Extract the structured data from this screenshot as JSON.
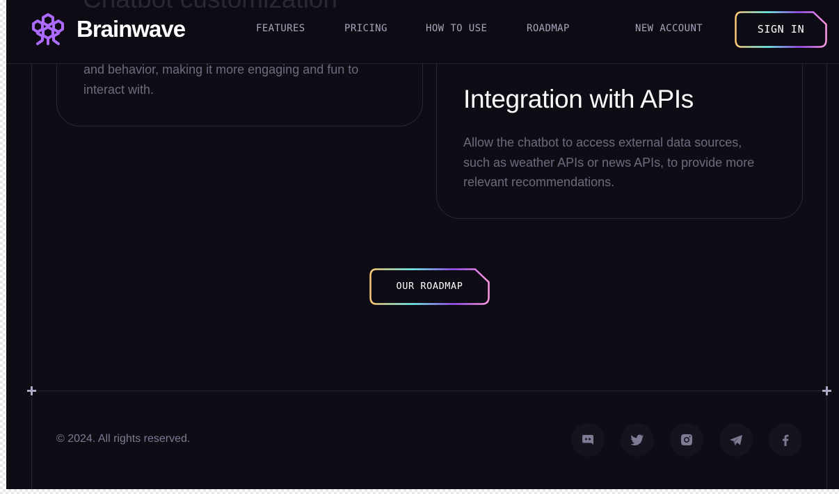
{
  "header": {
    "brand": "Brainwave",
    "ghost_title": "Chatbot customization",
    "nav": [
      {
        "label": "FEATURES"
      },
      {
        "label": "PRICING"
      },
      {
        "label": "HOW TO USE"
      },
      {
        "label": "ROADMAP"
      }
    ],
    "new_account": "NEW ACCOUNT",
    "sign_in": "SIGN IN"
  },
  "cards": {
    "left": {
      "text_partial_line": "and behavior, making it more engaging and fun to",
      "text_last_line": "interact with."
    },
    "right": {
      "title": "Integration with APIs",
      "text_line1": "Allow the chatbot to access external data sources,",
      "text_line2": "such as weather APIs or news APIs, to provide more",
      "text_line3": "relevant recommendations."
    }
  },
  "roadmap_button": "OUR ROADMAP",
  "footer": {
    "copyright": "© 2024. All rights reserved.",
    "socials": [
      "discord-icon",
      "twitter-icon",
      "instagram-icon",
      "telegram-icon",
      "facebook-icon"
    ]
  },
  "colors": {
    "background": "#0e0c15",
    "border": "#26242c",
    "text_muted": "#7f7a93",
    "logo_purple": "#ac6aff",
    "gradient": [
      "#ffc876",
      "#79fff7",
      "#9f53ff",
      "#ff98e2"
    ]
  }
}
